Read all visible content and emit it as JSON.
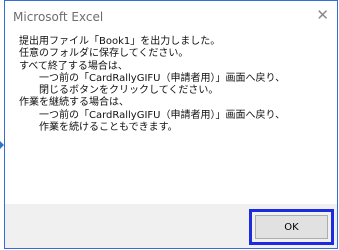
{
  "dialog": {
    "title": "Microsoft Excel",
    "close_glyph": "✕",
    "message": "提出用ファイル「Book1」を出力しました。\n任意のフォルダに保存してください。\nすべて終了する場合は、\n　　一つ前の「CardRallyGIFU（申請者用）」画面へ戻り、\n　　閉じるボタンをクリックしてください。\n作業を継続する場合は、\n　　一つ前の「CardRallyGIFU（申請者用）」画面へ戻り、\n　　作業を続けることもできます。",
    "ok_label": "OK"
  },
  "colors": {
    "highlight_border": "#1d2be0",
    "dialog_border": "#2f6fd6",
    "footer_bg": "#f0f0f0"
  },
  "icons": {
    "close": "close-icon",
    "pointer": "arrow-pointer-icon"
  }
}
